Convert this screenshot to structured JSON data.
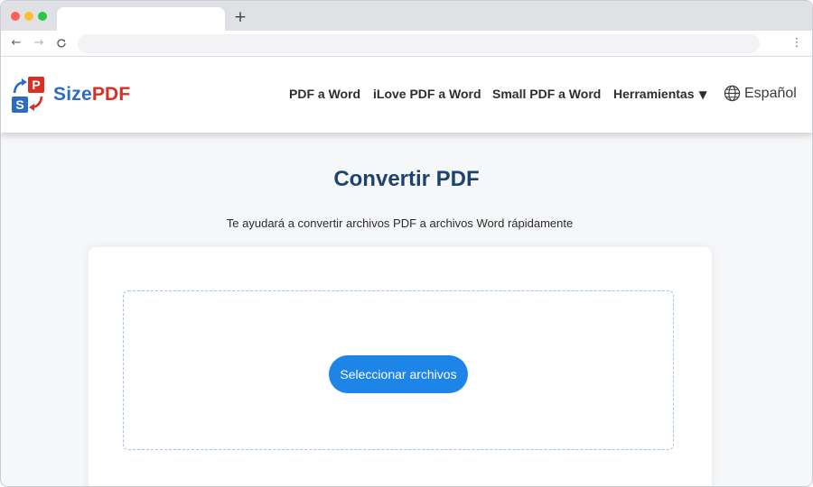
{
  "browser": {
    "tab_title": "",
    "new_tab_icon": "plus-icon",
    "back_icon": "arrow-left-icon",
    "forward_icon": "arrow-right-icon",
    "reload_icon": "reload-icon",
    "address_value": "",
    "menu_icon": "kebab-menu-icon"
  },
  "header": {
    "logo_icon": "sizepdf-logo-icon",
    "brand_part1": "Size",
    "brand_part2": "PDF",
    "nav": [
      {
        "label": "PDF a Word"
      },
      {
        "label": "iLove PDF a Word"
      },
      {
        "label": "Small PDF a Word"
      },
      {
        "label": "Herramientas"
      }
    ],
    "dropdown_icon": "triangle-down-icon",
    "language_icon": "globe-icon",
    "language": "Español"
  },
  "main": {
    "title": "Convertir PDF",
    "subtitle": "Te ayudará a convertir archivos PDF a archivos Word rápidamente",
    "select_button": "Seleccionar archivos"
  },
  "colors": {
    "brand_blue": "#2b6cc4",
    "brand_red": "#d93025",
    "title_navy": "#1e4272",
    "button_blue": "#1d84e8"
  }
}
